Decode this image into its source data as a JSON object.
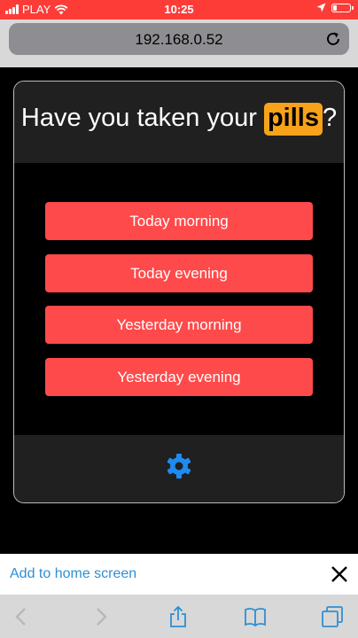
{
  "status_bar": {
    "carrier": "PLAY",
    "time": "10:25",
    "icons": [
      "signal-icon",
      "wifi-icon",
      "location-icon",
      "battery-icon"
    ],
    "battery_level": 0.2
  },
  "browser": {
    "url": "192.168.0.52",
    "reload_icon": "reload-icon"
  },
  "app": {
    "title_before": "Have you taken your ",
    "title_highlight": "pills",
    "title_after": "?",
    "buttons": [
      {
        "label": "Today morning"
      },
      {
        "label": "Today evening"
      },
      {
        "label": "Yesterday morning"
      },
      {
        "label": "Yesterday evening"
      }
    ],
    "settings_icon": "gear-icon"
  },
  "banner": {
    "label": "Add to home screen",
    "close_icon": "close-icon"
  },
  "toolbar": {
    "icons": [
      "back-icon",
      "forward-icon",
      "share-icon",
      "bookmarks-icon",
      "tabs-icon"
    ]
  },
  "colors": {
    "status_bar": "#fd3c38",
    "highlight": "#f7a21a",
    "button": "#fe4a4a",
    "accent": "#2e8fd4",
    "card_panel": "#202020"
  }
}
